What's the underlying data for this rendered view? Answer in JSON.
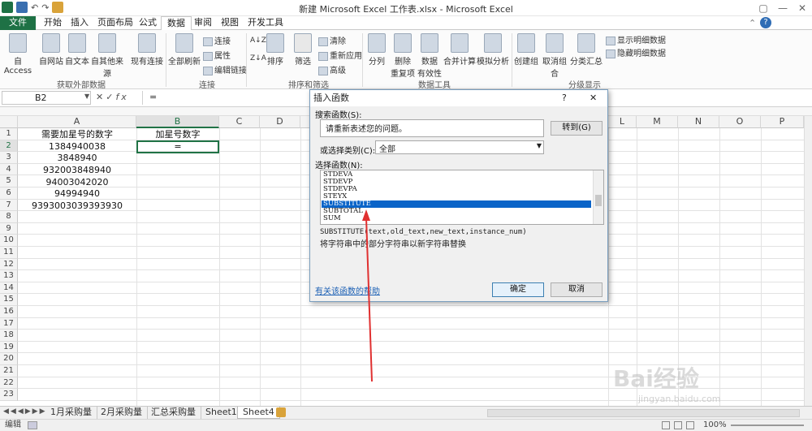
{
  "titlebar": {
    "title": "新建 Microsoft Excel 工作表.xlsx - Microsoft Excel"
  },
  "tabs": [
    "文件",
    "开始",
    "插入",
    "页面布局",
    "公式",
    "数据",
    "审阅",
    "视图",
    "开发工具"
  ],
  "ribbon": {
    "external": {
      "access": "自 Access",
      "web": "自网站",
      "text": "自文本",
      "other": "自其他来源",
      "existing": "现有连接",
      "group": "获取外部数据"
    },
    "connections": {
      "refresh": "全部刷新",
      "conn": "连接",
      "props": "属性",
      "edit": "编辑链接",
      "group": "连接"
    },
    "sort": {
      "sort": "排序",
      "filter": "筛选",
      "clear": "清除",
      "reapply": "重新应用",
      "advanced": "高级",
      "group": "排序和筛选"
    },
    "tools": {
      "split": "分列",
      "remove1": "删除",
      "remove2": "重复项",
      "valid1": "数据",
      "valid2": "有效性",
      "consolidate": "合并计算",
      "whatif": "模拟分析",
      "group": "数据工具"
    },
    "outline": {
      "group_btn": "创建组",
      "ungroup": "取消组合",
      "subtotal": "分类汇总",
      "show": "显示明细数据",
      "hide": "隐藏明细数据",
      "group": "分级显示"
    }
  },
  "formula": {
    "namebox": "B2",
    "fx": "fx",
    "value": "="
  },
  "columns": [
    "A",
    "B",
    "C",
    "D",
    "E",
    "F",
    "G",
    "H",
    "I",
    "J",
    "K",
    "L",
    "M",
    "N",
    "O",
    "P"
  ],
  "rows": [
    "1",
    "2",
    "3",
    "4",
    "5",
    "6",
    "7",
    "8",
    "9",
    "10",
    "11",
    "12",
    "13",
    "14",
    "15",
    "16",
    "17",
    "18",
    "19",
    "20",
    "21",
    "22",
    "23"
  ],
  "cells": {
    "a1": "需要加星号的数字",
    "b1": "加星号数字",
    "a2": "1384940038",
    "b2": "=",
    "a3": "3848940",
    "a4": "932003848940",
    "a5": "94003042020",
    "a6": "94994940",
    "a7": "9393003039393930"
  },
  "sheets": [
    "1月采购量",
    "2月采购量",
    "汇总采购量",
    "Sheet1",
    "Sheet4"
  ],
  "status": {
    "mode": "编辑",
    "zoom": "100%"
  },
  "dialog": {
    "title": "插入函数",
    "help": "?",
    "close": "✕",
    "search_label": "搜索函数(S):",
    "search_value": "请重新表述您的问题。",
    "goto": "转到(G)",
    "category_label": "或选择类别(C):",
    "category_value": "全部",
    "select_label": "选择函数(N):",
    "functions": [
      "STDEVA",
      "STDEVP",
      "STDEVPA",
      "STEYX",
      "SUBSTITUTE",
      "SUBTOTAL",
      "SUM"
    ],
    "selected": "SUBSTITUTE",
    "syntax": "SUBSTITUTE(text,old_text,new_text,instance_num)",
    "desc": "将字符串中的部分字符串以新字符串替换",
    "helplink": "有关该函数的帮助",
    "ok": "确定",
    "cancel": "取消"
  },
  "watermark": {
    "brand": "Bai经验",
    "url": "jingyan.baidu.com"
  },
  "colors": {
    "excel_green": "#1e7145",
    "select_blue": "#0a64c8",
    "arrow_red": "#e03030"
  }
}
